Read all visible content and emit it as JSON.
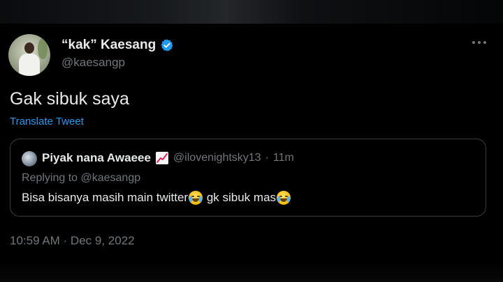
{
  "tweet": {
    "author": {
      "display_name": "“kak” Kaesang",
      "handle": "@kaesangp",
      "verified_color": "#1d9bf0"
    },
    "text": "Gak sibuk saya",
    "translate_label": "Translate Tweet",
    "timestamp": "10:59 AM · Dec 9, 2022"
  },
  "quoted_tweet": {
    "display_name": "Piyak nana Awaeee",
    "name_emoji": "chart-increasing-icon",
    "handle": "@ilovenightsky13",
    "separator": "·",
    "time": "11m",
    "replying_to": "Replying to @kaesangp",
    "text_part1": "Bisa bisanya masih main twitter",
    "emoji1": "loudly-crying-face-icon",
    "text_part2": " gk sibuk mas",
    "emoji2": "face-with-tears-of-joy-icon"
  },
  "colors": {
    "background": "#000000",
    "primary_text": "#e7e9ea",
    "secondary_text": "#71767b",
    "link": "#1d9bf0",
    "border": "#3a3e42"
  }
}
